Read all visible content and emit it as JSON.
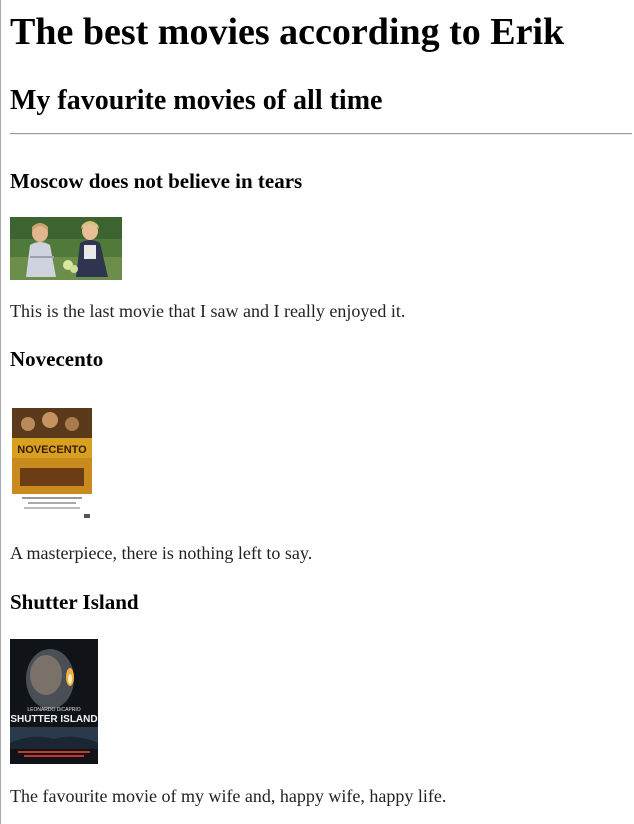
{
  "page": {
    "title": "The best movies according to Erik",
    "subtitle": "My favourite movies of all time"
  },
  "movies": [
    {
      "title": "Moscow does not believe in tears",
      "description": "This is the last movie that I saw and I really enjoyed it.",
      "image": "movie-still-two-girls"
    },
    {
      "title": "Novecento",
      "description": "A masterpiece, there is nothing left to say.",
      "image": "novecento-poster",
      "poster_text": "NOVECENTO"
    },
    {
      "title": "Shutter Island",
      "description": "The favourite movie of my wife and, happy wife, happy life.",
      "image": "shutter-island-poster",
      "poster_text": "SHUTTER ISLAND",
      "poster_actor": "LEONARDO DiCAPRIO"
    }
  ]
}
